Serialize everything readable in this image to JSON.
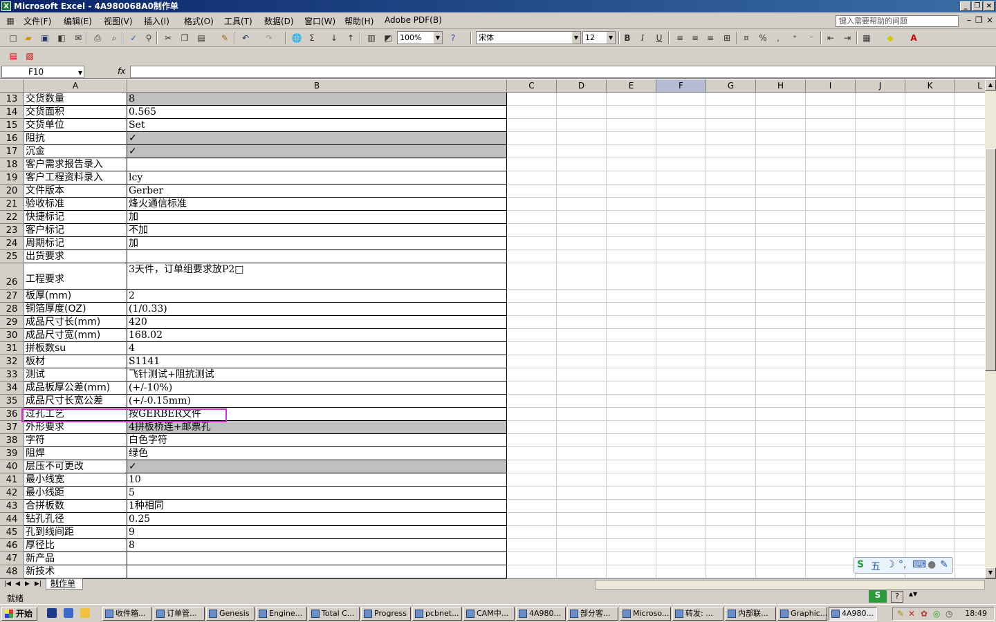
{
  "window": {
    "title": "Microsoft Excel - 4A980068A0制作单",
    "xl_icon": "X"
  },
  "menu": {
    "items": [
      "文件(F)",
      "编辑(E)",
      "视图(V)",
      "插入(I)",
      "格式(O)",
      "工具(T)",
      "数据(D)",
      "窗口(W)",
      "帮助(H)",
      "Adobe PDF(B)"
    ],
    "help_placeholder": "键入需要帮助的问题"
  },
  "toolbar": {
    "zoom": "100%",
    "font": "宋体",
    "size": "12",
    "bold": "B",
    "italic": "I",
    "underline": "U",
    "percent": "%"
  },
  "formula_bar": {
    "cell_ref": "F10",
    "fx": "fx",
    "value": ""
  },
  "columns": [
    "A",
    "B",
    "C",
    "D",
    "E",
    "F",
    "G",
    "H",
    "I",
    "J",
    "K",
    "L"
  ],
  "selected_column": "F",
  "rows": [
    {
      "n": "13",
      "a": "交货数量",
      "b": "8",
      "gray": true
    },
    {
      "n": "14",
      "a": "交货面积",
      "b": "0.565"
    },
    {
      "n": "15",
      "a": "交货单位",
      "b": "Set"
    },
    {
      "n": "16",
      "a": "阻抗",
      "b": "✓",
      "gray": true
    },
    {
      "n": "17",
      "a": "沉金",
      "b": "✓",
      "gray": true
    },
    {
      "n": "18",
      "a": "客户需求报告录入",
      "b": ""
    },
    {
      "n": "19",
      "a": "客户工程资料录入",
      "b": "lcy"
    },
    {
      "n": "20",
      "a": "文件版本",
      "b": "Gerber"
    },
    {
      "n": "21",
      "a": "验收标准",
      "b": "烽火通信标准"
    },
    {
      "n": "22",
      "a": "快捷标记",
      "b": "加"
    },
    {
      "n": "23",
      "a": "客户标记",
      "b": "不加"
    },
    {
      "n": "24",
      "a": "周期标记",
      "b": "加"
    },
    {
      "n": "25",
      "a": "出货要求",
      "b": ""
    },
    {
      "n": "26",
      "a": "工程要求",
      "b": "3天件，订单组要求放P2□",
      "tall": true
    },
    {
      "n": "27",
      "a": "板厚(mm)",
      "b": "2"
    },
    {
      "n": "28",
      "a": "铜箔厚度(OZ)",
      "b": "(1/0.33)"
    },
    {
      "n": "29",
      "a": "成品尺寸长(mm)",
      "b": "420"
    },
    {
      "n": "30",
      "a": "成品尺寸宽(mm)",
      "b": "168.02"
    },
    {
      "n": "31",
      "a": "拼板数su",
      "b": "4"
    },
    {
      "n": "32",
      "a": "板材",
      "b": "S1141"
    },
    {
      "n": "33",
      "a": "测试",
      "b": "飞针测试+阻抗测试"
    },
    {
      "n": "34",
      "a": "成品板厚公差(mm)",
      "b": "(+/-10%)"
    },
    {
      "n": "35",
      "a": "成品尺寸长宽公差",
      "b": "(+/-0.15mm)"
    },
    {
      "n": "36",
      "a": "过孔工艺",
      "b": "按GERBER文件"
    },
    {
      "n": "37",
      "a": "外形要求",
      "b": "4拼板桥连+邮票孔",
      "gray": true
    },
    {
      "n": "38",
      "a": "字符",
      "b": "白色字符"
    },
    {
      "n": "39",
      "a": "阻焊",
      "b": "绿色"
    },
    {
      "n": "40",
      "a": "层压不可更改",
      "b": "✓",
      "gray": true
    },
    {
      "n": "41",
      "a": "最小线宽",
      "b": "10"
    },
    {
      "n": "42",
      "a": "最小线距",
      "b": "5"
    },
    {
      "n": "43",
      "a": "合拼板数",
      "b": "1种相同"
    },
    {
      "n": "44",
      "a": "钻孔孔径",
      "b": "0.25"
    },
    {
      "n": "45",
      "a": "孔到线间距",
      "b": "9"
    },
    {
      "n": "46",
      "a": "厚径比",
      "b": "8"
    },
    {
      "n": "47",
      "a": "新产品",
      "b": ""
    },
    {
      "n": "48",
      "a": "新技术",
      "b": ""
    }
  ],
  "sheet_tab": "制作单",
  "status": "就绪",
  "ime": {
    "mode": "五"
  },
  "taskbar": {
    "start": "开始",
    "tasks": [
      "收件箱...",
      "订单管...",
      "Genesis",
      "Engine...",
      "Total C...",
      "Progress",
      "pcbnet...",
      "CAM中...",
      "4A980...",
      "部分客...",
      "Microso...",
      "转发: ...",
      "内部联...",
      "Graphic...",
      "4A980..."
    ],
    "clock": "18:49"
  }
}
